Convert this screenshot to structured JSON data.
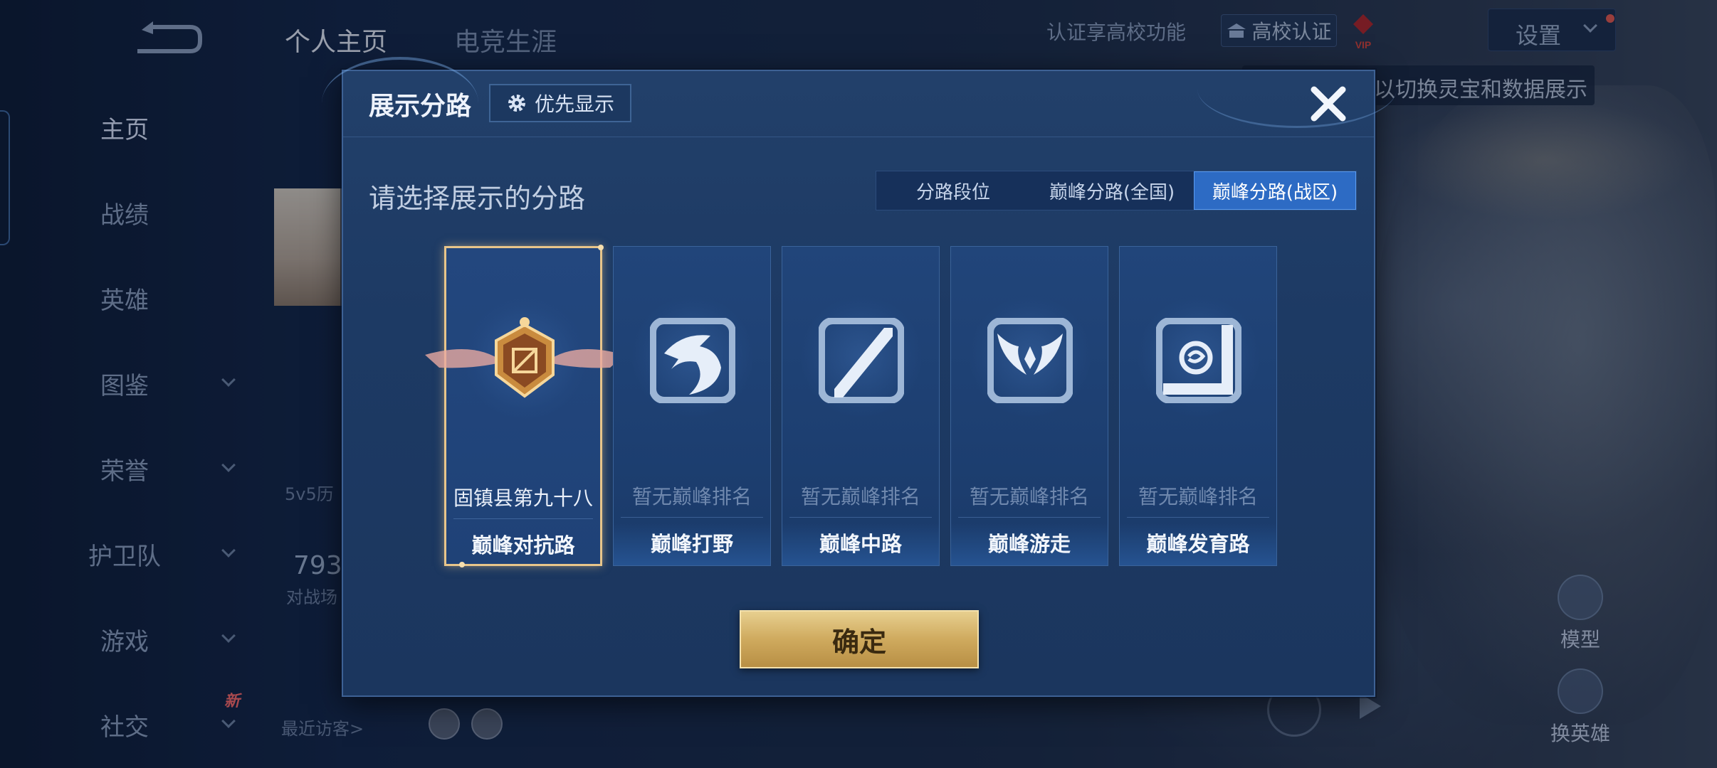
{
  "background": {
    "back_label": "",
    "top_tabs": [
      "个人主页",
      "电竞生涯"
    ],
    "nav_items": [
      {
        "label": "主页",
        "chevron": false
      },
      {
        "label": "战绩",
        "chevron": false
      },
      {
        "label": "英雄",
        "chevron": false
      },
      {
        "label": "图鉴",
        "chevron": true
      },
      {
        "label": "荣誉",
        "chevron": true
      },
      {
        "label": "护卫队",
        "chevron": true
      },
      {
        "label": "游戏",
        "chevron": true
      },
      {
        "label": "社交",
        "chevron": true
      }
    ],
    "new_badge": "新",
    "campus_text": "认证享高校功能",
    "campus_button": "高校认证",
    "settings_label": "设置",
    "hint_text": "以切换灵宝和数据展示",
    "history_label": "5v5历",
    "battle_count": "793",
    "battle_label": "对战场",
    "recent_visitors": "最近访客>",
    "model_button": "模型",
    "change_hero_button": "换英雄",
    "vip_label": "VIP",
    "accent_gold": "#e8c58a",
    "accent_blue": "#2d6bc4"
  },
  "modal": {
    "title": "展示分路",
    "priority_button": "优先显示",
    "subtitle": "请选择展示的分路",
    "segments": [
      {
        "label": "分路段位",
        "active": false
      },
      {
        "label": "巅峰分路(全国)",
        "active": false
      },
      {
        "label": "巅峰分路(战区)",
        "active": true
      }
    ],
    "cards": [
      {
        "lane": "巅峰对抗路",
        "rank": "固镇县第九十八",
        "icon": "clash-lane-emblem-icon",
        "selected": true
      },
      {
        "lane": "巅峰打野",
        "rank": "暂无巅峰排名",
        "icon": "jungle-dragon-icon",
        "selected": false
      },
      {
        "lane": "巅峰中路",
        "rank": "暂无巅峰排名",
        "icon": "mid-lane-slash-icon",
        "selected": false
      },
      {
        "lane": "巅峰游走",
        "rank": "暂无巅峰排名",
        "icon": "roam-wings-icon",
        "selected": false
      },
      {
        "lane": "巅峰发育路",
        "rank": "暂无巅峰排名",
        "icon": "farm-lane-corner-icon",
        "selected": false
      }
    ],
    "confirm_button": "确定"
  }
}
